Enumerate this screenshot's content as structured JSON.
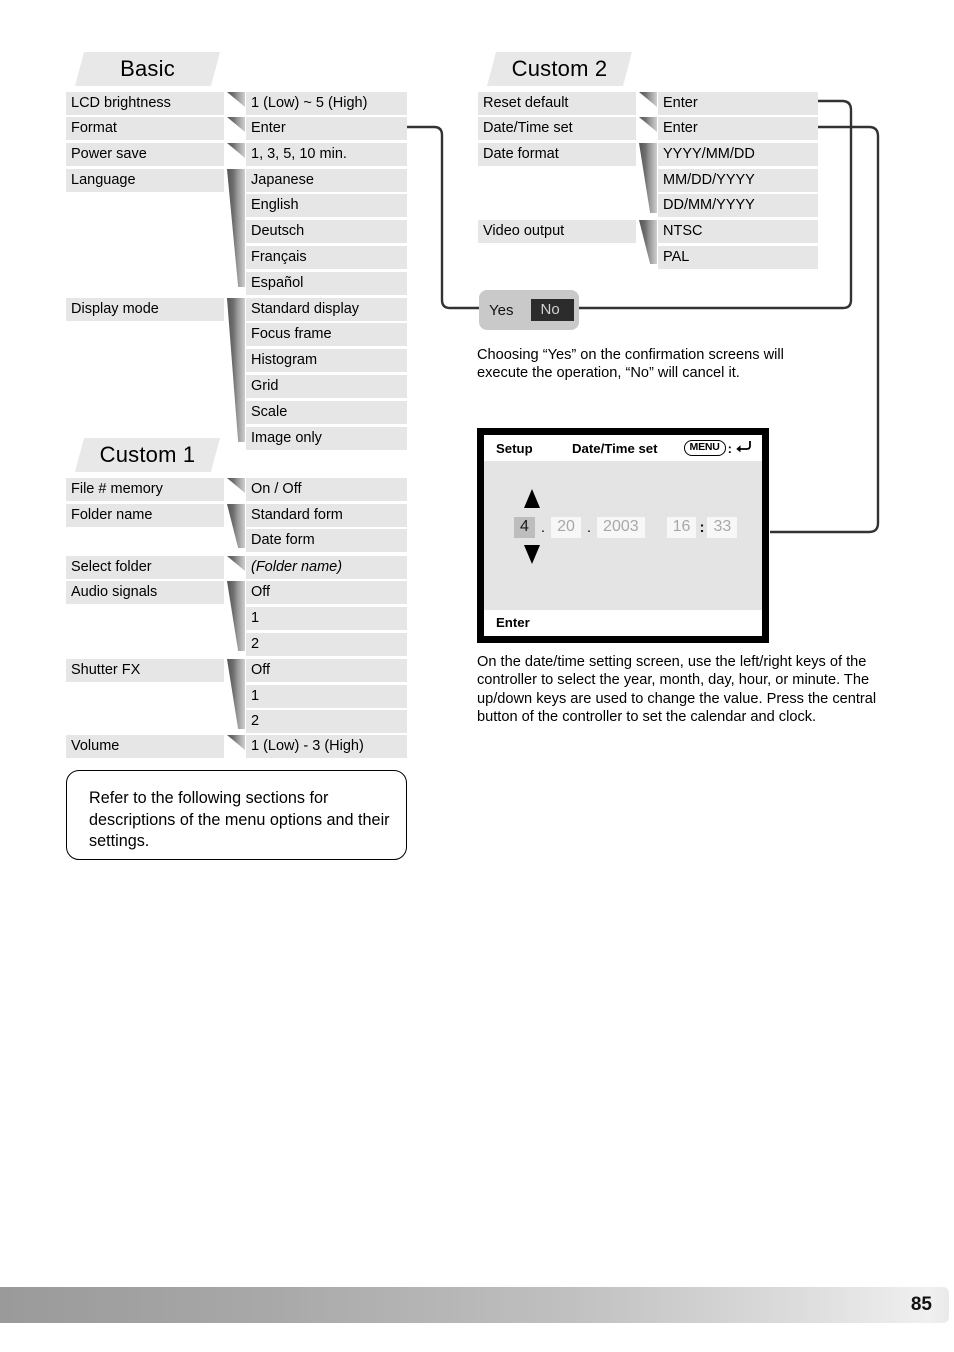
{
  "page": {
    "number": "85"
  },
  "sections": {
    "basic": {
      "title": "Basic",
      "items": [
        {
          "label": "LCD brightness",
          "options": [
            "1 (Low) ~ 5 (High)"
          ]
        },
        {
          "label": "Format",
          "options": [
            "Enter"
          ]
        },
        {
          "label": "Power save",
          "options": [
            "1, 3, 5, 10 min."
          ]
        },
        {
          "label": "Language",
          "options": [
            "Japanese",
            "English",
            "Deutsch",
            "Français",
            "Español"
          ]
        },
        {
          "label": "Display mode",
          "options": [
            "Standard display",
            "Focus frame",
            "Histogram",
            "Grid",
            "Scale",
            "Image only"
          ]
        }
      ]
    },
    "custom1": {
      "title": "Custom 1",
      "items": [
        {
          "label": "File # memory",
          "options": [
            "On / Off"
          ]
        },
        {
          "label": "Folder name",
          "options": [
            "Standard form",
            "Date form"
          ]
        },
        {
          "label": "Select folder",
          "options": [
            "(Folder name)"
          ]
        },
        {
          "label": "Audio signals",
          "options": [
            "Off",
            "1",
            "2"
          ]
        },
        {
          "label": "Shutter FX",
          "options": [
            "Off",
            "1",
            "2"
          ]
        },
        {
          "label": "Volume",
          "options": [
            "1 (Low) - 3 (High)"
          ]
        }
      ]
    },
    "custom2": {
      "title": "Custom 2",
      "items": [
        {
          "label": "Reset default",
          "options": [
            "Enter"
          ]
        },
        {
          "label": "Date/Time set",
          "options": [
            "Enter"
          ]
        },
        {
          "label": "Date format",
          "options": [
            "YYYY/MM/DD",
            "MM/DD/YYYY",
            "DD/MM/YYYY"
          ]
        },
        {
          "label": "Video output",
          "options": [
            "NTSC",
            "PAL"
          ]
        }
      ]
    }
  },
  "confirm_box": {
    "yes_label": "Yes",
    "no_label": "No"
  },
  "paragraphs": {
    "confirmation": "Choosing “Yes” on the confirmation screens will execute the operation, “No” will cancel it.",
    "datetime": "On the date/time setting screen, use the left/right keys of the controller to select the year, month, day, hour, or minute. The up/down keys are used to change the value. Press the central button of the controller to set the calendar and clock."
  },
  "note_box": {
    "text": "Refer to the following sections for descriptions of the menu options and their settings."
  },
  "lcd_screen": {
    "mode_label": "Setup",
    "title": "Date/Time set",
    "menu_button_label": "MENU",
    "menu_colon": ":",
    "enter_label": "Enter",
    "fields": {
      "month": "4",
      "day": "20",
      "year": "2003",
      "hour": "16",
      "minute": "33"
    },
    "separators": {
      "date_sep": ".",
      "time_sep": ":"
    }
  },
  "colors": {
    "row_bg": "#e6e6e6",
    "header_bg": "#e8e8e8",
    "confirm_bg": "#c9c9c9",
    "confirm_selected_bg": "#2c2c2c",
    "lcd_bg": "#e4e4e4",
    "line": "#333333"
  }
}
